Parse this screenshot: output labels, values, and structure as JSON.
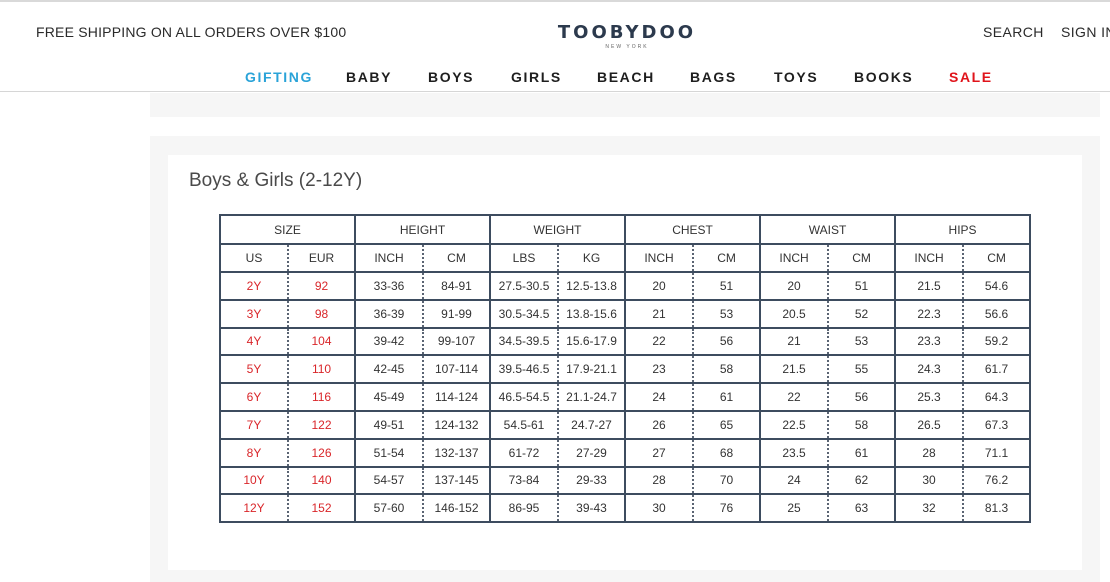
{
  "header": {
    "promo": "FREE SHIPPING ON ALL ORDERS OVER $100",
    "logo": {
      "main": "TOOBYDOO",
      "sub": "NEW YORK"
    },
    "search": "SEARCH",
    "signin": "SIGN IN"
  },
  "nav": [
    {
      "label": "GIFTING",
      "color": "#2aa3d8"
    },
    {
      "label": "BABY"
    },
    {
      "label": "BOYS"
    },
    {
      "label": "GIRLS"
    },
    {
      "label": "BEACH"
    },
    {
      "label": "BAGS"
    },
    {
      "label": "TOYS"
    },
    {
      "label": "BOOKS"
    },
    {
      "label": "SALE",
      "color": "#e0141b"
    }
  ],
  "size_chart": {
    "title": "Boys & Girls (2-12Y)",
    "groups": [
      "SIZE",
      "HEIGHT",
      "WEIGHT",
      "CHEST",
      "WAIST",
      "HIPS"
    ],
    "subheaders": [
      "US",
      "EUR",
      "INCH",
      "CM",
      "LBS",
      "KG",
      "INCH",
      "CM",
      "INCH",
      "CM",
      "INCH",
      "CM"
    ],
    "rows": [
      [
        "2Y",
        "92",
        "33-36",
        "84-91",
        "27.5-30.5",
        "12.5-13.8",
        "20",
        "51",
        "20",
        "51",
        "21.5",
        "54.6"
      ],
      [
        "3Y",
        "98",
        "36-39",
        "91-99",
        "30.5-34.5",
        "13.8-15.6",
        "21",
        "53",
        "20.5",
        "52",
        "22.3",
        "56.6"
      ],
      [
        "4Y",
        "104",
        "39-42",
        "99-107",
        "34.5-39.5",
        "15.6-17.9",
        "22",
        "56",
        "21",
        "53",
        "23.3",
        "59.2"
      ],
      [
        "5Y",
        "110",
        "42-45",
        "107-114",
        "39.5-46.5",
        "17.9-21.1",
        "23",
        "58",
        "21.5",
        "55",
        "24.3",
        "61.7"
      ],
      [
        "6Y",
        "116",
        "45-49",
        "114-124",
        "46.5-54.5",
        "21.1-24.7",
        "24",
        "61",
        "22",
        "56",
        "25.3",
        "64.3"
      ],
      [
        "7Y",
        "122",
        "49-51",
        "124-132",
        "54.5-61",
        "24.7-27",
        "26",
        "65",
        "22.5",
        "58",
        "26.5",
        "67.3"
      ],
      [
        "8Y",
        "126",
        "51-54",
        "132-137",
        "61-72",
        "27-29",
        "27",
        "68",
        "23.5",
        "61",
        "28",
        "71.1"
      ],
      [
        "10Y",
        "140",
        "54-57",
        "137-145",
        "73-84",
        "29-33",
        "28",
        "70",
        "24",
        "62",
        "30",
        "76.2"
      ],
      [
        "12Y",
        "152",
        "57-60",
        "146-152",
        "86-95",
        "39-43",
        "30",
        "76",
        "25",
        "63",
        "32",
        "81.3"
      ]
    ],
    "colors": {
      "border": "#3d4c5f",
      "size_text": "#d9262a"
    }
  }
}
